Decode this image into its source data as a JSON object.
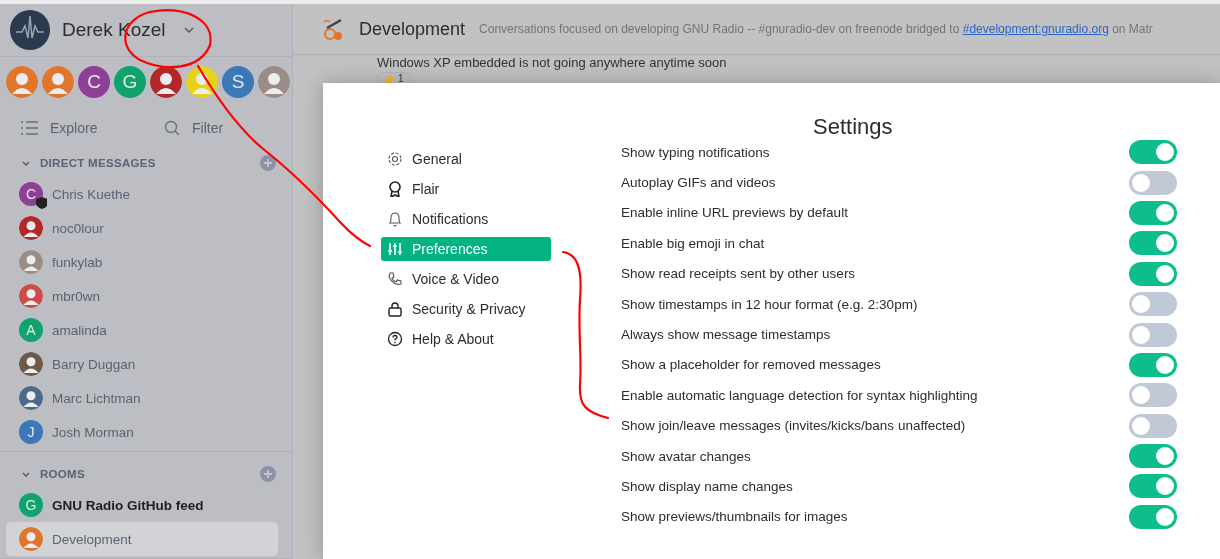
{
  "user": {
    "name": "Derek Kozel"
  },
  "spaces": [
    {
      "kind": "image",
      "color": "#e0752b"
    },
    {
      "kind": "image",
      "color": "#e0752b"
    },
    {
      "kind": "letter",
      "letter": "C",
      "color": "#8e3f96"
    },
    {
      "kind": "letter",
      "letter": "G",
      "color": "#10a36d"
    },
    {
      "kind": "image",
      "color": "#b3262a"
    },
    {
      "kind": "image",
      "color": "#e6d21c"
    },
    {
      "kind": "letter",
      "letter": "S",
      "color": "#3a78b8"
    },
    {
      "kind": "image",
      "color": "#9a8c86"
    }
  ],
  "explore": {
    "label": "Explore"
  },
  "filter": {
    "placeholder": "Filter"
  },
  "direct_messages": {
    "title": "DIRECT MESSAGES",
    "expanded": true,
    "items": [
      {
        "name": "Chris Kuethe",
        "kind": "letter",
        "letter": "C",
        "color": "#8e3f96",
        "badge": true
      },
      {
        "name": "noc0lour",
        "kind": "image",
        "color": "#b3262a",
        "badge": false
      },
      {
        "name": "funkylab",
        "kind": "image",
        "color": "#9a8c86",
        "badge": false
      },
      {
        "name": "mbr0wn",
        "kind": "image",
        "color": "#cf4b4b",
        "badge": false
      },
      {
        "name": "amalinda",
        "kind": "letter",
        "letter": "A",
        "color": "#10a36d",
        "badge": false
      },
      {
        "name": "Barry Duggan",
        "kind": "image",
        "color": "#6d5a4a",
        "badge": false
      },
      {
        "name": "Marc Lichtman",
        "kind": "image",
        "color": "#4d6a8a",
        "badge": false
      },
      {
        "name": "Josh Morman",
        "kind": "letter",
        "letter": "J",
        "color": "#3a78b8",
        "badge": false
      }
    ]
  },
  "rooms": {
    "title": "ROOMS",
    "expanded": true,
    "items": [
      {
        "name": "GNU Radio GitHub feed",
        "kind": "letter",
        "letter": "G",
        "color": "#10a36d",
        "unread": true,
        "selected": false
      },
      {
        "name": "Development",
        "kind": "image",
        "color": "#e0752b",
        "unread": false,
        "selected": true
      }
    ]
  },
  "room": {
    "name": "Development",
    "topic": "Conversations focused on developing GNU Radio -- #gnuradio-dev on freenode bridged to",
    "topic_link": "#development:gnuradio.org",
    "topic_end": "on Matr"
  },
  "message": {
    "text": "Windows XP embedded is not going anywhere anytime soon",
    "reaction_count": "1"
  },
  "settings": {
    "title": "Settings",
    "nav": [
      {
        "label": "General",
        "selected": false
      },
      {
        "label": "Flair",
        "selected": false
      },
      {
        "label": "Notifications",
        "selected": false
      },
      {
        "label": "Preferences",
        "selected": true
      },
      {
        "label": "Voice & Video",
        "selected": false
      },
      {
        "label": "Security & Privacy",
        "selected": false
      },
      {
        "label": "Help & About",
        "selected": false
      }
    ],
    "options": [
      {
        "label": "Show typing notifications",
        "on": true
      },
      {
        "label": "Autoplay GIFs and videos",
        "on": false
      },
      {
        "label": "Enable inline URL previews by default",
        "on": true
      },
      {
        "label": "Enable big emoji in chat",
        "on": true
      },
      {
        "label": "Show read receipts sent by other users",
        "on": true
      },
      {
        "label": "Show timestamps in 12 hour format (e.g. 2:30pm)",
        "on": false
      },
      {
        "label": "Always show message timestamps",
        "on": false
      },
      {
        "label": "Show a placeholder for removed messages",
        "on": true
      },
      {
        "label": "Enable automatic language detection for syntax highlighting",
        "on": false
      },
      {
        "label": "Show join/leave messages (invites/kicks/bans unaffected)",
        "on": false
      },
      {
        "label": "Show avatar changes",
        "on": true
      },
      {
        "label": "Show display name changes",
        "on": true
      },
      {
        "label": "Show previews/thumbnails for images",
        "on": true
      }
    ]
  }
}
